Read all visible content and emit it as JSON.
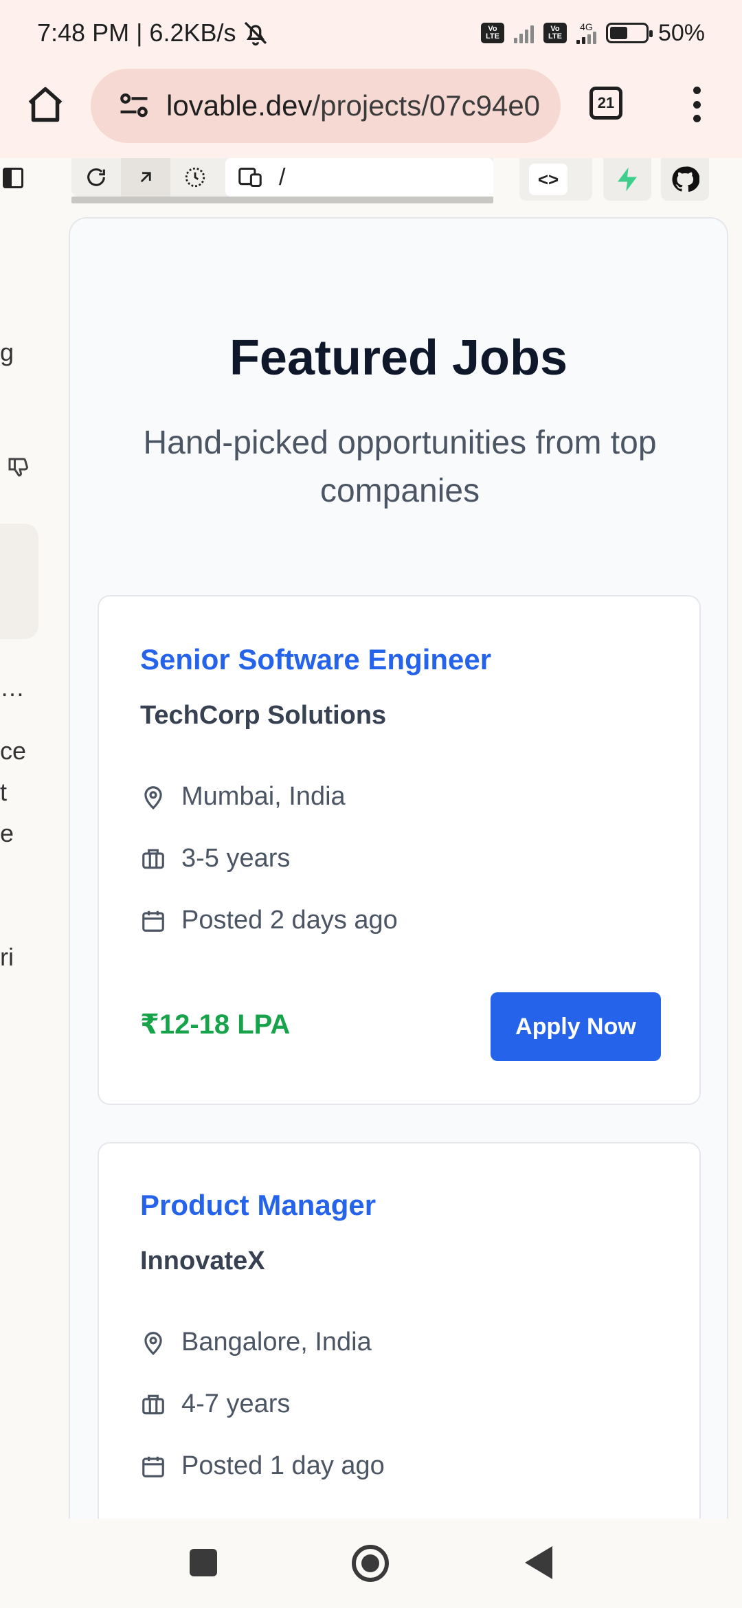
{
  "status_bar": {
    "time_speed": "7:48 PM | 6.2KB/s",
    "sim1_label": "Vo LTE",
    "sim2_label": "Vo LTE",
    "network_label": "4G",
    "battery": "50%",
    "battery_level": 0.5
  },
  "browser": {
    "url_domain": "lovable.dev",
    "url_path": "/projects/07c94e0",
    "tab_count": "21"
  },
  "toolbar": {
    "route": "/",
    "code_label": "<>"
  },
  "chat_fragments": [
    "g",
    "…",
    "ce",
    "t",
    "e",
    "ri"
  ],
  "preview": {
    "title": "Featured Jobs",
    "subtitle": "Hand-picked opportunities from top companies",
    "jobs": [
      {
        "title": "Senior Software Engineer",
        "company": "TechCorp Solutions",
        "location": "Mumbai, India",
        "experience": "3-5 years",
        "posted": "Posted 2 days ago",
        "salary": "₹12-18 LPA",
        "apply_label": "Apply Now"
      },
      {
        "title": "Product Manager",
        "company": "InnovateX",
        "location": "Bangalore, India",
        "experience": "4-7 years",
        "posted": "Posted 1 day ago"
      }
    ]
  },
  "icons": {
    "location": "map-pin-icon",
    "experience": "briefcase-icon",
    "posted": "calendar-icon"
  },
  "colors": {
    "job_title": "#2563eb",
    "salary": "#16a34a",
    "apply_button": "#2563eb",
    "status_bg": "#fdf0ed"
  }
}
